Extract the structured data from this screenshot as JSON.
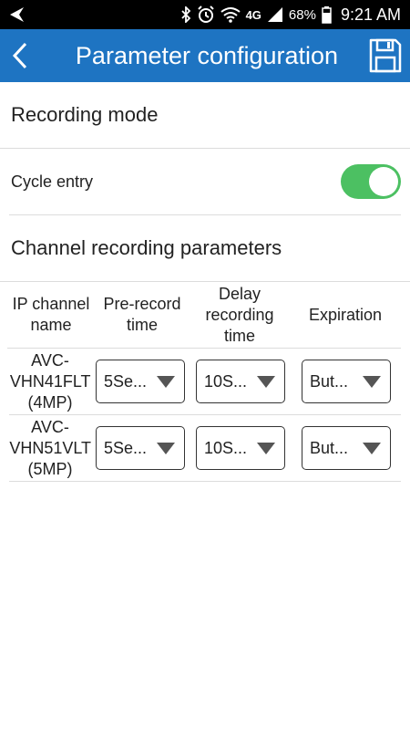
{
  "status": {
    "time": "9:21 AM",
    "battery": "68%",
    "network": "4G"
  },
  "header": {
    "title": "Parameter configuration",
    "accent": "#1e74c2"
  },
  "recording_mode": {
    "title": "Recording mode"
  },
  "cycle_entry": {
    "label": "Cycle entry",
    "enabled": true,
    "toggle_color": "#4cc062"
  },
  "channel_params": {
    "title": "Channel recording parameters",
    "columns": {
      "name": "IP channel name",
      "pre_record": "Pre-record time",
      "delay": "Delay recording time",
      "expiration": "Expiration"
    },
    "rows": [
      {
        "name": "AVC-VHN41FLT (4MP)",
        "pre_record": "5Se...",
        "delay": "10S...",
        "expiration": "But..."
      },
      {
        "name": "AVC-VHN51VLT (5MP)",
        "pre_record": "5Se...",
        "delay": "10S...",
        "expiration": "But..."
      }
    ]
  }
}
